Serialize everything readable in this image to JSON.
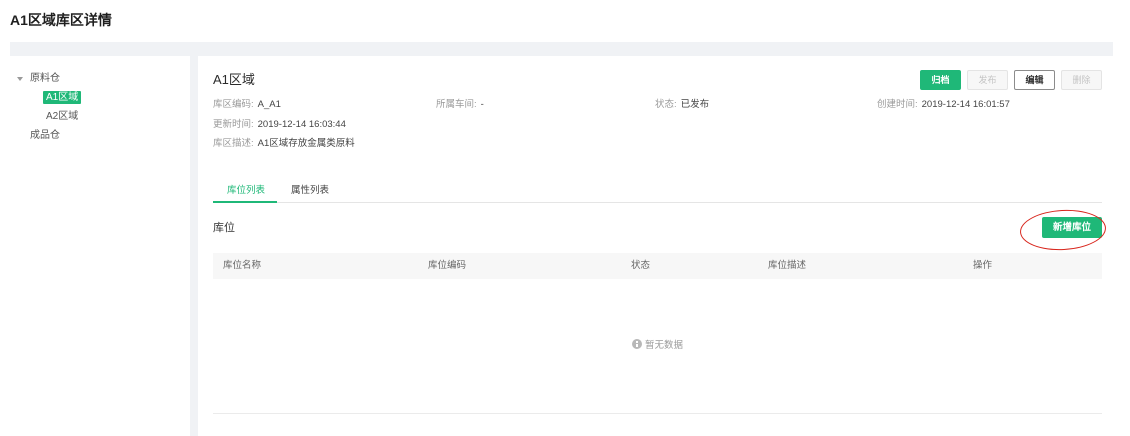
{
  "theme": {
    "accent": "#1fb878",
    "annotation": "#d8251c"
  },
  "icons": {
    "tree_caret": "caret-down-icon",
    "empty_state": "info-icon"
  },
  "page": {
    "title": "A1区域库区详情"
  },
  "tree": {
    "nodes": [
      {
        "label": "原料仓",
        "expanded": true,
        "children": [
          {
            "label": "A1区域",
            "selected": true
          },
          {
            "label": "A2区域"
          }
        ]
      },
      {
        "label": "成品仓"
      }
    ]
  },
  "detail": {
    "title": "A1区域",
    "actions": [
      {
        "label": "归档",
        "primary": true,
        "disabled": false
      },
      {
        "label": "发布",
        "disabled": true
      },
      {
        "label": "编辑",
        "disabled": false
      },
      {
        "label": "删除",
        "disabled": true
      }
    ],
    "fields": [
      {
        "label": "库区编码:",
        "value": "A_A1"
      },
      {
        "label": "所属车间:",
        "value": "-"
      },
      {
        "label": "状态:",
        "value": "已发布"
      },
      {
        "label": "创建时间:",
        "value": "2019-12-14 16:01:57"
      },
      {
        "label": "更新时间:",
        "value": "2019-12-14 16:03:44"
      },
      {
        "label": "库区描述:",
        "value": "A1区域存放金属类原料"
      }
    ],
    "tabs": {
      "items": [
        "库位列表",
        "属性列表"
      ],
      "active": 0
    }
  },
  "locations": {
    "section_title": "库位",
    "add_button": "新增库位",
    "table": {
      "columns": [
        "库位名称",
        "库位编码",
        "状态",
        "库位描述",
        "操作"
      ],
      "rows": [],
      "empty_text": "暂无数据"
    }
  }
}
